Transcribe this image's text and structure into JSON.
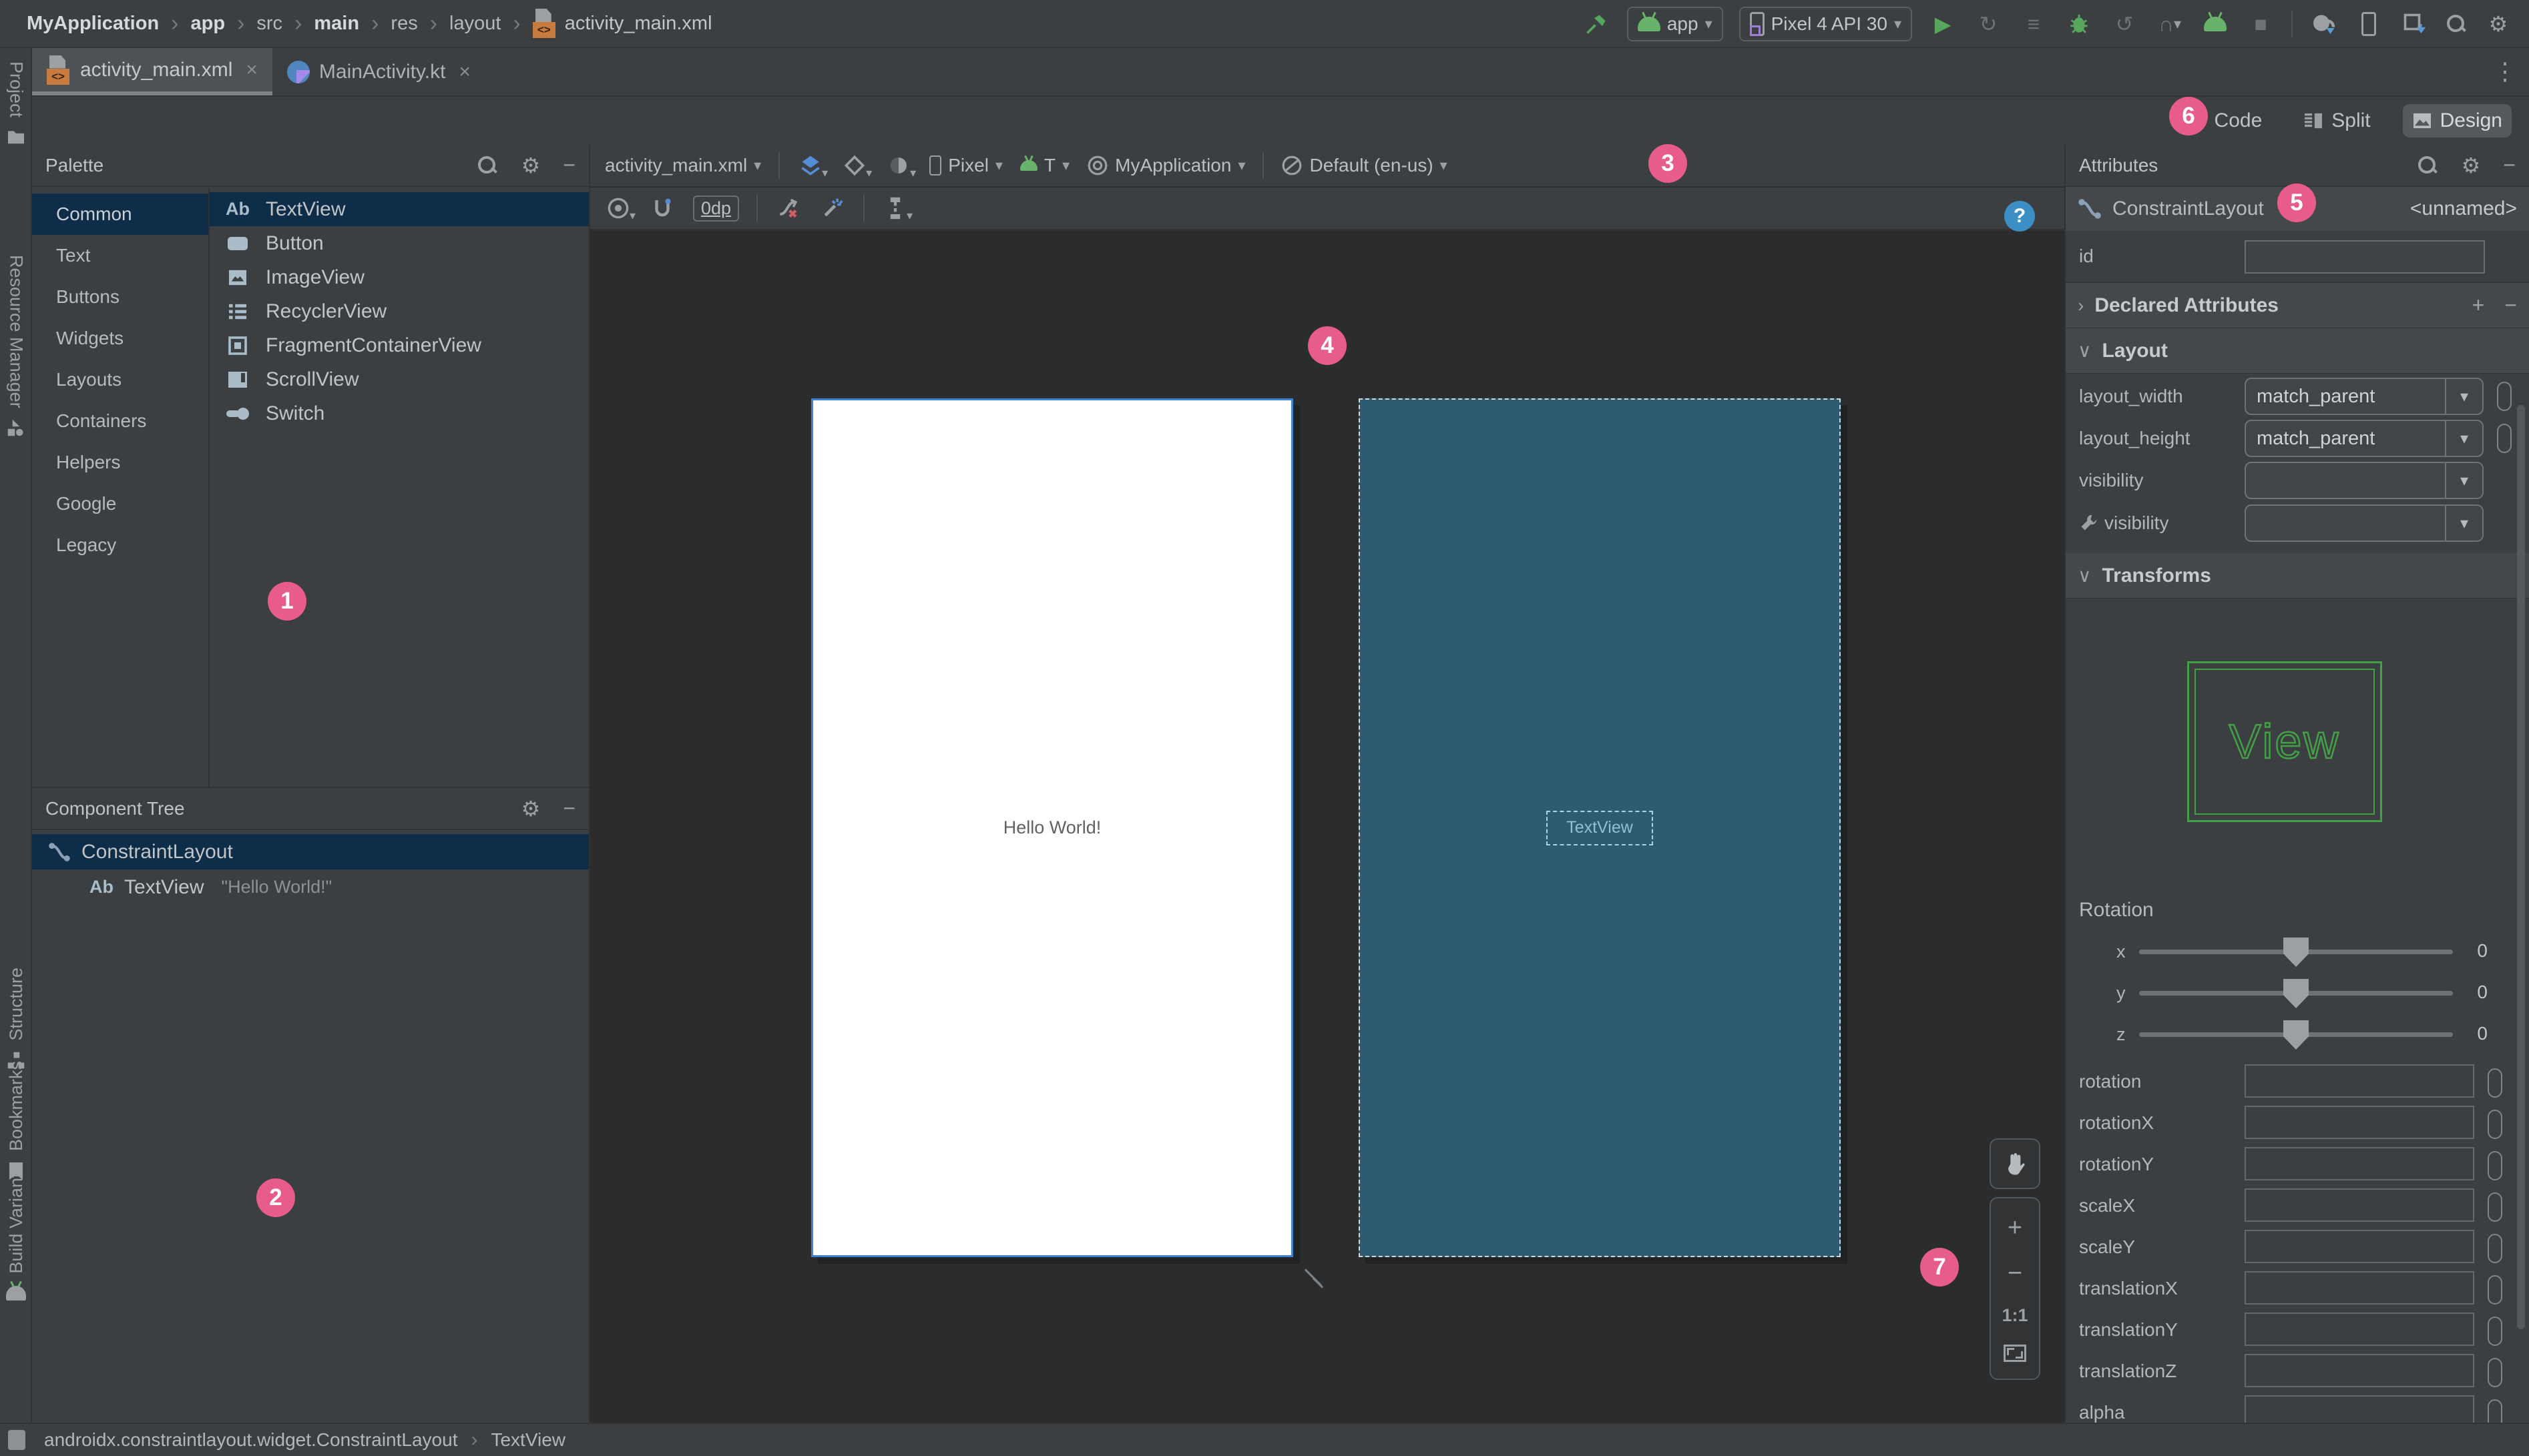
{
  "breadcrumb": {
    "items": [
      {
        "label": "MyApplication",
        "bold": true
      },
      {
        "label": "app",
        "bold": true
      },
      {
        "label": "src",
        "bold": false
      },
      {
        "label": "main",
        "bold": true
      },
      {
        "label": "res",
        "bold": false
      },
      {
        "label": "layout",
        "bold": false
      }
    ],
    "file": "activity_main.xml",
    "separator": "›"
  },
  "main_toolbar": {
    "run_config": "app",
    "device": "Pixel 4 API 30"
  },
  "tabs": {
    "tab1": "activity_main.xml",
    "tab2": "MainActivity.kt"
  },
  "stripe": {
    "project": "Project",
    "resource_manager": "Resource Manager",
    "structure": "Structure",
    "bookmarks": "Bookmarks",
    "build_variants": "Build Variants"
  },
  "view_modes": {
    "code": "Code",
    "split": "Split",
    "design": "Design"
  },
  "palette": {
    "title": "Palette",
    "categories": [
      {
        "label": "Common",
        "selected": true
      },
      {
        "label": "Text"
      },
      {
        "label": "Buttons"
      },
      {
        "label": "Widgets"
      },
      {
        "label": "Layouts"
      },
      {
        "label": "Containers"
      },
      {
        "label": "Helpers"
      },
      {
        "label": "Google"
      },
      {
        "label": "Legacy"
      }
    ],
    "items": [
      {
        "label": "TextView"
      },
      {
        "label": "Button"
      },
      {
        "label": "ImageView"
      },
      {
        "label": "RecyclerView"
      },
      {
        "label": "FragmentContainerView"
      },
      {
        "label": "ScrollView"
      },
      {
        "label": "Switch"
      }
    ]
  },
  "component_tree": {
    "title": "Component Tree",
    "root_label": "ConstraintLayout",
    "child_label": "TextView",
    "child_text": "\"Hello World!\""
  },
  "design_toolbar": {
    "file": "activity_main.xml",
    "device": "Pixel",
    "api": "T",
    "theme": "MyApplication",
    "locale": "Default (en-us)",
    "margin": "0dp"
  },
  "canvas": {
    "hello_text": "Hello World!",
    "textview_label": "TextView"
  },
  "zoom_controls": {
    "actual_size": "1:1"
  },
  "attributes": {
    "title": "Attributes",
    "component": "ConstraintLayout",
    "instance": "<unnamed>",
    "id_label": "id",
    "declared_header": "Declared Attributes",
    "layout_header": "Layout",
    "layout_width_label": "layout_width",
    "layout_width_value": "match_parent",
    "layout_height_label": "layout_height",
    "layout_height_value": "match_parent",
    "visibility_label": "visibility",
    "tools_visibility_label": "visibility",
    "transforms_header": "Transforms",
    "view_text": "View",
    "rotation_label": "Rotation",
    "sliders": [
      {
        "axis": "x",
        "value": "0"
      },
      {
        "axis": "y",
        "value": "0"
      },
      {
        "axis": "z",
        "value": "0"
      }
    ],
    "fields": [
      "rotation",
      "rotationX",
      "rotationY",
      "scaleX",
      "scaleY",
      "translationX",
      "translationY",
      "translationZ",
      "alpha"
    ]
  },
  "status_bar": {
    "component_path": "androidx.constraintlayout.widget.ConstraintLayout",
    "selected": "TextView"
  },
  "badges": [
    "1",
    "2",
    "3",
    "4",
    "5",
    "6",
    "7"
  ],
  "glyphs": {
    "chevron_right": "›",
    "chevron_down": "∨",
    "caret": "▾",
    "plus": "+",
    "minus": "−",
    "kebab": "⋮",
    "close": "×",
    "gear": "⚙",
    "run": "▶",
    "stop": "■",
    "list": "≡",
    "redo": "↻",
    "undo": "↺",
    "profiler": "∩",
    "ab": "Ab",
    "question": "?"
  },
  "colors": {
    "annotation_pink": "#e75c8a",
    "blueprint_background": "#2e5b6f",
    "selection_blue": "#0d2d48",
    "transform_green": "#43a047",
    "layers_blue": "#548cd6"
  }
}
